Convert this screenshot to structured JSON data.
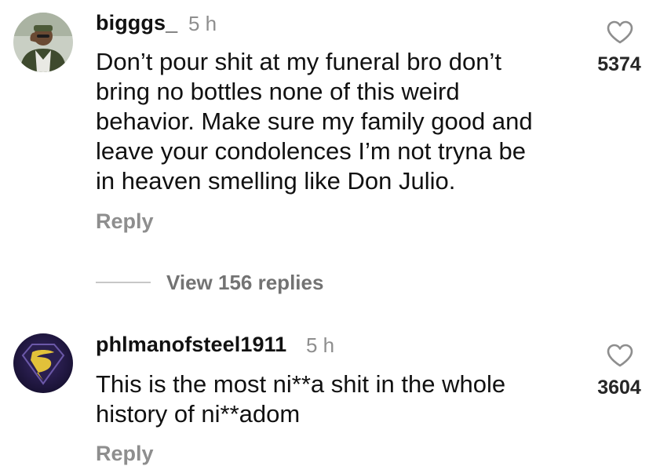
{
  "comments": [
    {
      "username": "bigggs_",
      "time": "5 h",
      "text": "Don’t pour shit at my funeral  bro don’t\nbring no bottles none of this weird\nbehavior. Make sure my family good and\nleave your condolences I’m not tryna be\nin heaven smelling like Don Julio.",
      "reply_label": "Reply",
      "likes": "5374",
      "avatar_icon": "user-avatar-photo",
      "like_icon": "heart-icon"
    },
    {
      "username": "phlmanofsteel1911",
      "time": "5 h",
      "text": "This is the most ni**a shit in the whole\nhistory of ni**adom",
      "reply_label": "Reply",
      "likes": "3604",
      "avatar_icon": "superman-logo-avatar",
      "like_icon": "heart-icon"
    }
  ],
  "view_replies": "View 156 replies",
  "colors": {
    "text": "#111111",
    "muted": "#8e8e8e",
    "divider": "#c7c7c7",
    "background": "#ffffff"
  }
}
